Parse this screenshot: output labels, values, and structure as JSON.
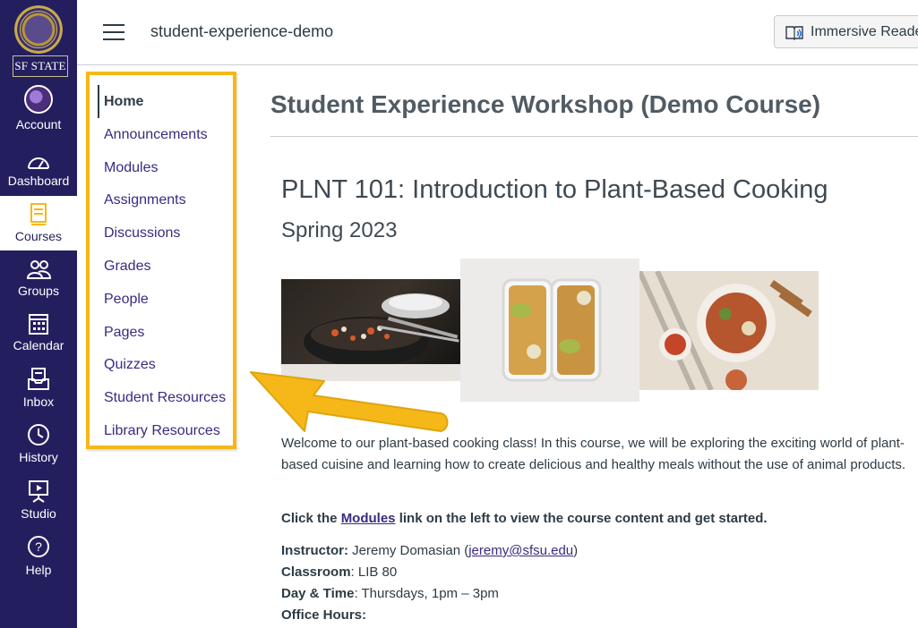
{
  "global_nav": {
    "logo_text": "SF STATE",
    "items": [
      {
        "label": "Account",
        "icon": "avatar"
      },
      {
        "label": "Dashboard",
        "icon": "dashboard-icon"
      },
      {
        "label": "Courses",
        "icon": "courses-icon",
        "active": true
      },
      {
        "label": "Groups",
        "icon": "groups-icon"
      },
      {
        "label": "Calendar",
        "icon": "calendar-icon"
      },
      {
        "label": "Inbox",
        "icon": "inbox-icon"
      },
      {
        "label": "History",
        "icon": "history-icon"
      },
      {
        "label": "Studio",
        "icon": "studio-icon"
      },
      {
        "label": "Help",
        "icon": "help-icon"
      }
    ]
  },
  "header": {
    "breadcrumb": "student-experience-demo",
    "immersive_reader": "Immersive Reader"
  },
  "course_nav": {
    "items": [
      {
        "label": "Home",
        "active": true
      },
      {
        "label": "Announcements"
      },
      {
        "label": "Modules"
      },
      {
        "label": "Assignments"
      },
      {
        "label": "Discussions"
      },
      {
        "label": "Grades"
      },
      {
        "label": "People"
      },
      {
        "label": "Pages"
      },
      {
        "label": "Quizzes"
      },
      {
        "label": "Student Resources"
      },
      {
        "label": "Library Resources"
      }
    ],
    "highlight_color": "#f5b818"
  },
  "main": {
    "page_title": "Student Experience Workshop (Demo Course)",
    "course_title": "PLNT 101: Introduction to Plant-Based Cooking",
    "term": "Spring 2023",
    "welcome": "Welcome to our plant-based cooking class! In this course, we will be exploring the exciting world of plant-based cuisine and learning how to create delicious and healthy meals without the use of animal products.",
    "cta_before": "Click the ",
    "cta_link": "Modules",
    "cta_after": " link on the left to view the course content and get started.",
    "instructor_label": "Instructor:",
    "instructor_name": " Jeremy Domasian (",
    "instructor_email": "jeremy@sfsu.edu",
    "instructor_close": ")",
    "classroom_label": "Classroom",
    "classroom_value": ": LIB 80",
    "daytime_label": "Day & Time",
    "daytime_value": ": Thursdays, 1pm – 3pm",
    "office_hours_label": "Office Hours:"
  },
  "colors": {
    "nav_bg": "#231f5f",
    "link": "#3b2a80",
    "arrow": "#f5b818"
  }
}
